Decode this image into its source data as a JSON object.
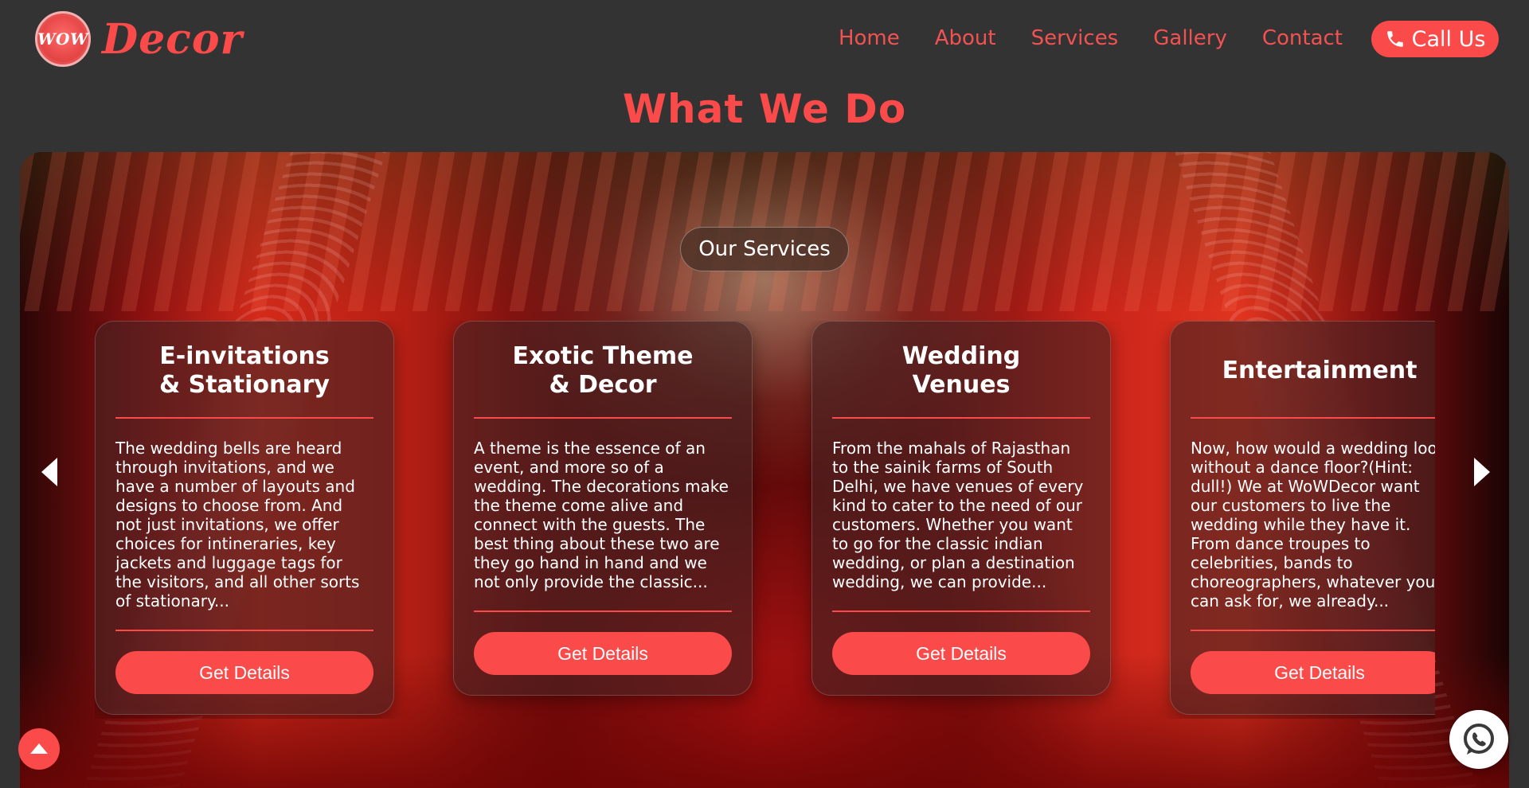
{
  "brand": {
    "logo_mark": "WOW",
    "name": "Decor"
  },
  "nav": {
    "items": [
      {
        "label": "Home"
      },
      {
        "label": "About"
      },
      {
        "label": "Services"
      },
      {
        "label": "Gallery"
      },
      {
        "label": "Contact"
      }
    ],
    "call_label": "Call Us",
    "call_icon": "phone-icon"
  },
  "section": {
    "title": "What We Do",
    "pill": "Our Services"
  },
  "cards": [
    {
      "title": "E-invitations\n& Stationary",
      "text": "The wedding bells are heard through invitations, and we have a number of layouts and designs to choose from. And not just invitations, we offer choices for intineraries, key jackets and luggage tags for the visitors, and all other sorts of stationary...",
      "button": "Get Details"
    },
    {
      "title": "Exotic Theme\n& Decor",
      "text": "A theme is the essence of an event, and more so of a wedding. The decorations make the theme come alive and connect with the guests. The best thing about these two are they go hand in hand and we not only provide the classic...",
      "button": "Get Details"
    },
    {
      "title": "Wedding\nVenues",
      "text": "From the mahals of Rajasthan to the sainik farms of South Delhi, we have venues of every kind to cater to the need of our customers. Whether you want to go for the classic indian wedding, or plan a destination wedding, we can provide...",
      "button": "Get Details"
    },
    {
      "title": "Entertainment",
      "text": "Now, how would a wedding look without a dance floor?(Hint: dull!) We at WoWDecor want our customers to live the wedding while they have it. From dance troupes to celebrities, bands to choreographers, whatever you can ask for, we already...",
      "button": "Get Details"
    }
  ],
  "colors": {
    "accent": "#fb4a4a",
    "background": "#333333"
  },
  "icons": {
    "prev": "chevron-left-icon",
    "next": "chevron-right-icon",
    "scroll_top": "caret-up-icon",
    "whatsapp": "whatsapp-icon"
  }
}
